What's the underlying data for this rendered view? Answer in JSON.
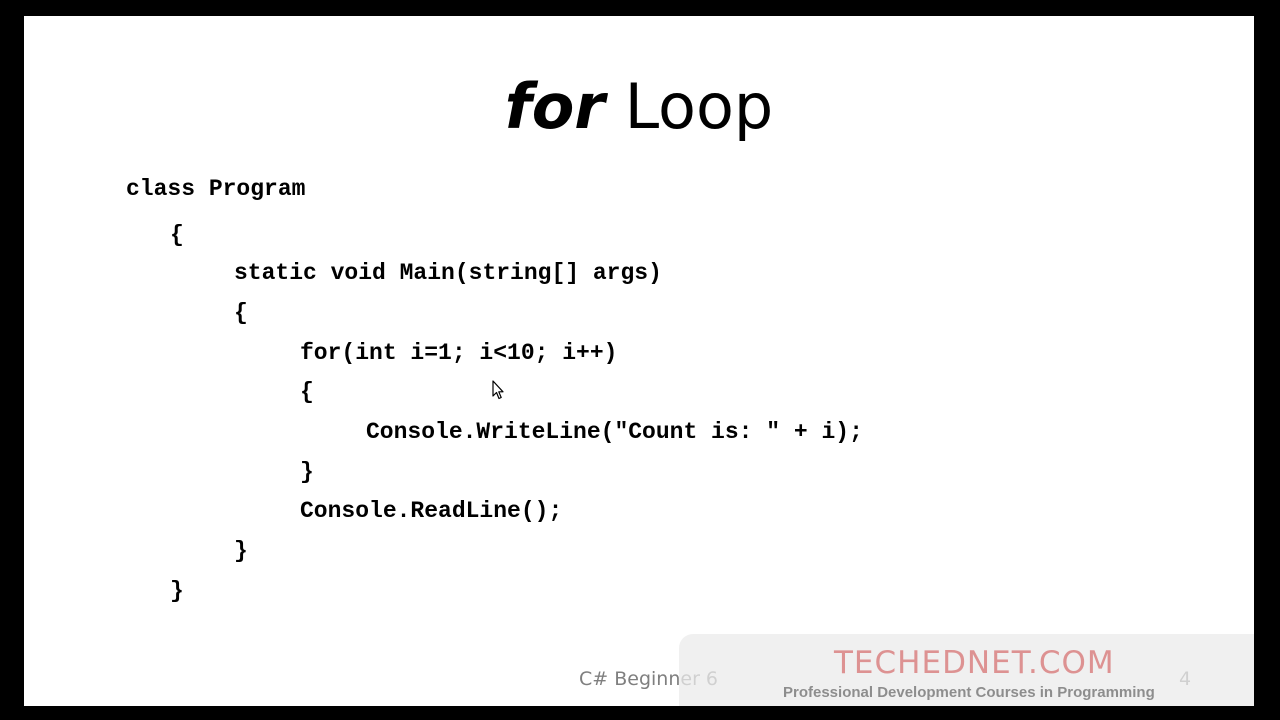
{
  "slide": {
    "title_keyword": "for",
    "title_rest": " Loop",
    "code_lines": [
      "class Program",
      "{",
      "static void Main(string[] args)",
      "{",
      "for(int i=1; i<10; i++)",
      "{",
      "Console.WriteLine(\"Count is: \" + i);",
      "}",
      "Console.ReadLine();",
      "}",
      "}"
    ],
    "footer": "C# Beginner 6",
    "slide_number": "4"
  },
  "watermark": {
    "brand": "TECHEDNET.COM",
    "tagline": "Professional Development Courses in Programming"
  },
  "colors": {
    "background": "#000000",
    "slide": "#ffffff",
    "text": "#000000",
    "footer_text": "#7f7f7f",
    "watermark_brand": "#cd4646"
  },
  "icons": {
    "cursor": "arrow-cursor-icon"
  }
}
